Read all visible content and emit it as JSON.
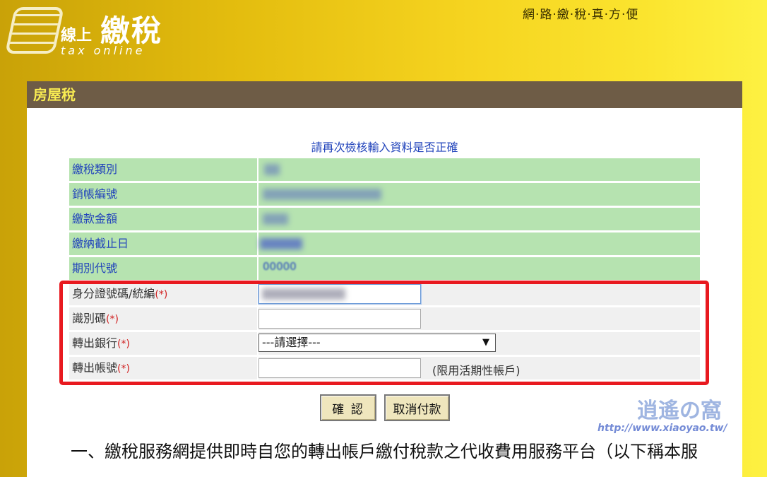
{
  "header": {
    "logo_chinese_small": "線上",
    "logo_chinese_big": "繳稅",
    "logo_english": "tax online",
    "slogan": "網‧路‧繳‧稅‧真‧方‧便"
  },
  "panel": {
    "title": "房屋稅",
    "notice": "請再次檢核輸入資料是否正確"
  },
  "info_rows": [
    {
      "label": "繳稅類別"
    },
    {
      "label": "銷帳編號"
    },
    {
      "label": "繳款金額"
    },
    {
      "label": "繳納截止日"
    },
    {
      "label": "期別代號",
      "value": "00000"
    }
  ],
  "form": {
    "required_mark": "(*)",
    "id_label": "身分證號碼/統編",
    "verify_label": "識別碼",
    "bank_label": "轉出銀行",
    "bank_selected": "---請選擇---",
    "account_label": "轉出帳號",
    "account_hint": "(限用活期性帳戶)"
  },
  "buttons": {
    "confirm": "確 認",
    "cancel": "取消付款"
  },
  "body_text": "一、繳稅服務網提供即時自您的轉出帳戶繳付稅款之代收費用服務平台（以下稱本服",
  "watermark": {
    "logo_text": "逍遙の窩",
    "url": "http://www.xiaoyao.tw/"
  },
  "colors": {
    "header_bar": "#6e5c46",
    "header_text": "#f9ec52",
    "info_row_bg": "#b6e3b0",
    "form_row_bg": "#f0f0f0",
    "highlight_border": "#e8191f",
    "button_bg": "#efe6bd"
  }
}
